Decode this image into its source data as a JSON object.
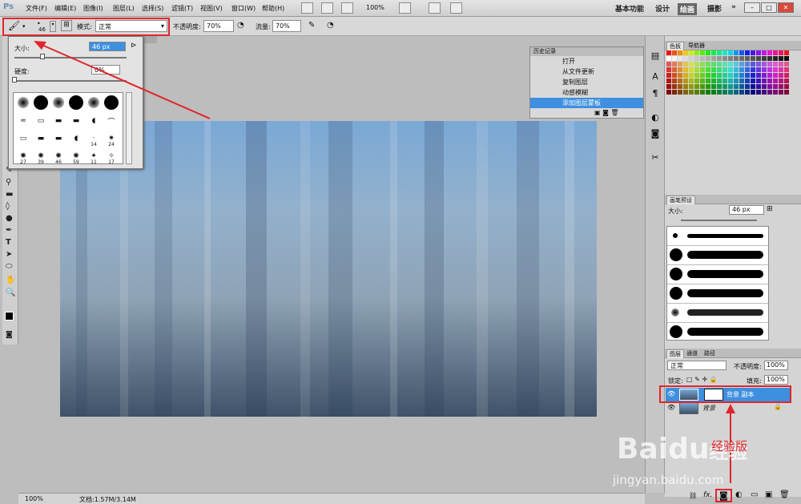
{
  "app": {
    "logo": "Ps"
  },
  "menu": [
    "文件(F)",
    "编辑(E)",
    "图像(I)",
    "图层(L)",
    "选择(S)",
    "滤镜(T)",
    "视图(V)",
    "窗口(W)",
    "帮助(H)"
  ],
  "top_zoom": "100%",
  "workspaces": {
    "basic": "基本功能",
    "design": "设计",
    "paint": "绘画",
    "photo": "摄影",
    "more": "»"
  },
  "options": {
    "brush_size": "46",
    "mode_label": "模式:",
    "mode_value": "正常",
    "opacity_label": "不透明度:",
    "opacity_value": "70%",
    "flow_label": "流量:",
    "flow_value": "70%"
  },
  "brush_picker": {
    "size_label": "大小:",
    "size_value": "46 px",
    "hardness_label": "硬度:",
    "hardness_value": "0%",
    "size_level": 0.25,
    "hardness_level": 0,
    "numbered": [
      "14",
      "24",
      "27",
      "39",
      "46",
      "59",
      "11",
      "17"
    ]
  },
  "history": {
    "title": "历史记录",
    "items": [
      "打开",
      "从文件更新",
      "复制图层",
      "动感模糊",
      "添加图层蒙板"
    ],
    "selected": 4
  },
  "color_panel": {
    "tab1": "色板",
    "tab2": "导航器"
  },
  "brush_presets": {
    "title": "画笔预设",
    "size_label": "大小:",
    "size_value": "46 px"
  },
  "layers_panel": {
    "tabs": [
      "图层",
      "通道",
      "路径"
    ],
    "blend_mode": "正常",
    "opacity_label": "不透明度:",
    "opacity_value": "100%",
    "lock_label": "锁定:",
    "fill_label": "填充:",
    "fill_value": "100%",
    "layers": [
      {
        "name": "背景 副本",
        "selected": true
      },
      {
        "name": "背景",
        "selected": false
      }
    ]
  },
  "status": {
    "zoom": "100%",
    "doc": "文档:1.57M/3.14M"
  },
  "watermark": {
    "brand": "Baidu",
    "sub": "经验",
    "url": "jingyan.baidu.com"
  },
  "annotation": {
    "text": "经验版"
  },
  "colors": {
    "accent_red": "#e0262c",
    "selection_blue": "#3d8fe0"
  }
}
